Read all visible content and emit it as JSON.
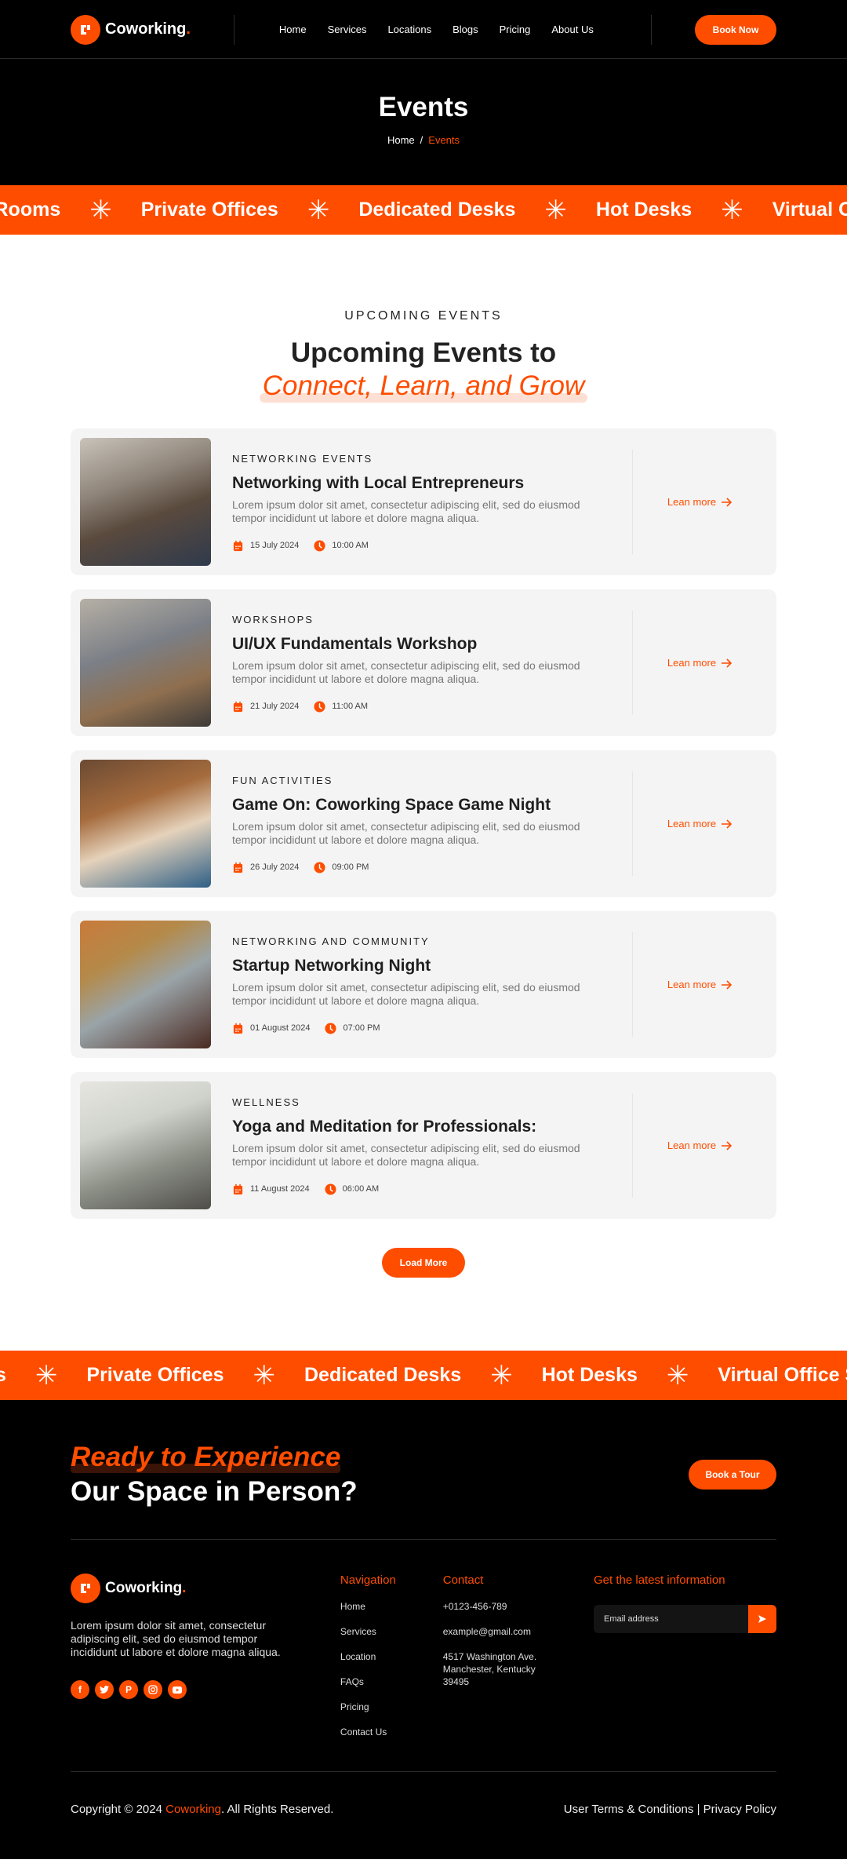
{
  "brand": {
    "name": "Coworking",
    "dot": ".",
    "accent_color": "#ff4d00"
  },
  "header": {
    "nav": [
      "Home",
      "Services",
      "Locations",
      "Blogs",
      "Pricing",
      "About Us"
    ],
    "cta_label": "Book Now"
  },
  "hero": {
    "title": "Events",
    "breadcrumb": {
      "home": "Home",
      "separator": "/",
      "current": "Events"
    }
  },
  "ticker_top": [
    "ng Rooms",
    "Private Offices",
    "Dedicated Desks",
    "Hot Desks",
    "Virtual O"
  ],
  "ticker_bottom": [
    "s",
    "Private Offices",
    "Dedicated Desks",
    "Hot Desks",
    "Virtual Office Servi"
  ],
  "events_section": {
    "eyebrow": "UPCOMING EVENTS",
    "title_line1": "Upcoming Events to",
    "title_line2": "Connect, Learn, and Grow",
    "learn_more_label": "Lean more",
    "load_more_label": "Load More",
    "events": [
      {
        "category": "NETWORKING EVENTS",
        "title": "Networking with Local Entrepreneurs",
        "description": "Lorem ipsum dolor sit amet, consectetur adipiscing elit, sed do eiusmod tempor incididunt ut labore et dolore magna aliqua.",
        "date": "15 July 2024",
        "time": "10:00 AM",
        "image": "group-networking-photo"
      },
      {
        "category": "WORKSHOPS",
        "title": "UI/UX Fundamentals Workshop",
        "description": "Lorem ipsum dolor sit amet, consectetur adipiscing elit, sed do eiusmod tempor incididunt ut labore et dolore magna aliqua.",
        "date": "21 July 2024",
        "time": "11:00 AM",
        "image": "workshop-photo"
      },
      {
        "category": "FUN ACTIVITIES",
        "title": "Game On: Coworking Space Game Night",
        "description": "Lorem ipsum dolor sit amet, consectetur adipiscing elit, sed do eiusmod tempor incididunt ut labore et dolore magna aliqua.",
        "date": "26 July 2024",
        "time": "09:00 PM",
        "image": "game-night-photo"
      },
      {
        "category": "NETWORKING AND COMMUNITY",
        "title": "Startup Networking Night",
        "description": "Lorem ipsum dolor sit amet, consectetur adipiscing elit, sed do eiusmod tempor incididunt ut labore et dolore magna aliqua.",
        "date": "01 August 2024",
        "time": "07:00 PM",
        "image": "handshake-photo"
      },
      {
        "category": "WELLNESS",
        "title": "Yoga and Meditation for Professionals:",
        "description": "Lorem ipsum dolor sit amet, consectetur adipiscing elit, sed do eiusmod tempor incididunt ut labore et dolore magna aliqua.",
        "date": "11 August 2024",
        "time": "06:00 AM",
        "image": "yoga-photo"
      }
    ]
  },
  "cta": {
    "line1": "Ready to Experience",
    "line2": "Our Space in Person?",
    "button_label": "Book a Tour"
  },
  "footer": {
    "description": "Lorem ipsum dolor sit amet, consectetur adipiscing elit, sed do eiusmod tempor incididunt ut labore et dolore magna aliqua.",
    "socials": [
      "facebook",
      "twitter",
      "pinterest",
      "instagram",
      "youtube"
    ],
    "navigation": {
      "heading": "Navigation",
      "links": [
        "Home",
        "Services",
        "Location",
        "FAQs",
        "Pricing",
        "Contact Us"
      ]
    },
    "contact": {
      "heading": "Contact",
      "phone": "+0123-456-789",
      "email": "example@gmail.com",
      "address": "4517 Washington Ave. Manchester, Kentucky 39495"
    },
    "newsletter": {
      "heading": "Get the latest information",
      "placeholder": "Email address"
    },
    "copyright_prefix": "Copyright © 2024 ",
    "copyright_brand": "Coworking",
    "copyright_suffix": ". All Rights Reserved.",
    "terms_label": "User Terms & Conditions",
    "legal_separator": " | ",
    "privacy_label": "Privacy Policy"
  }
}
